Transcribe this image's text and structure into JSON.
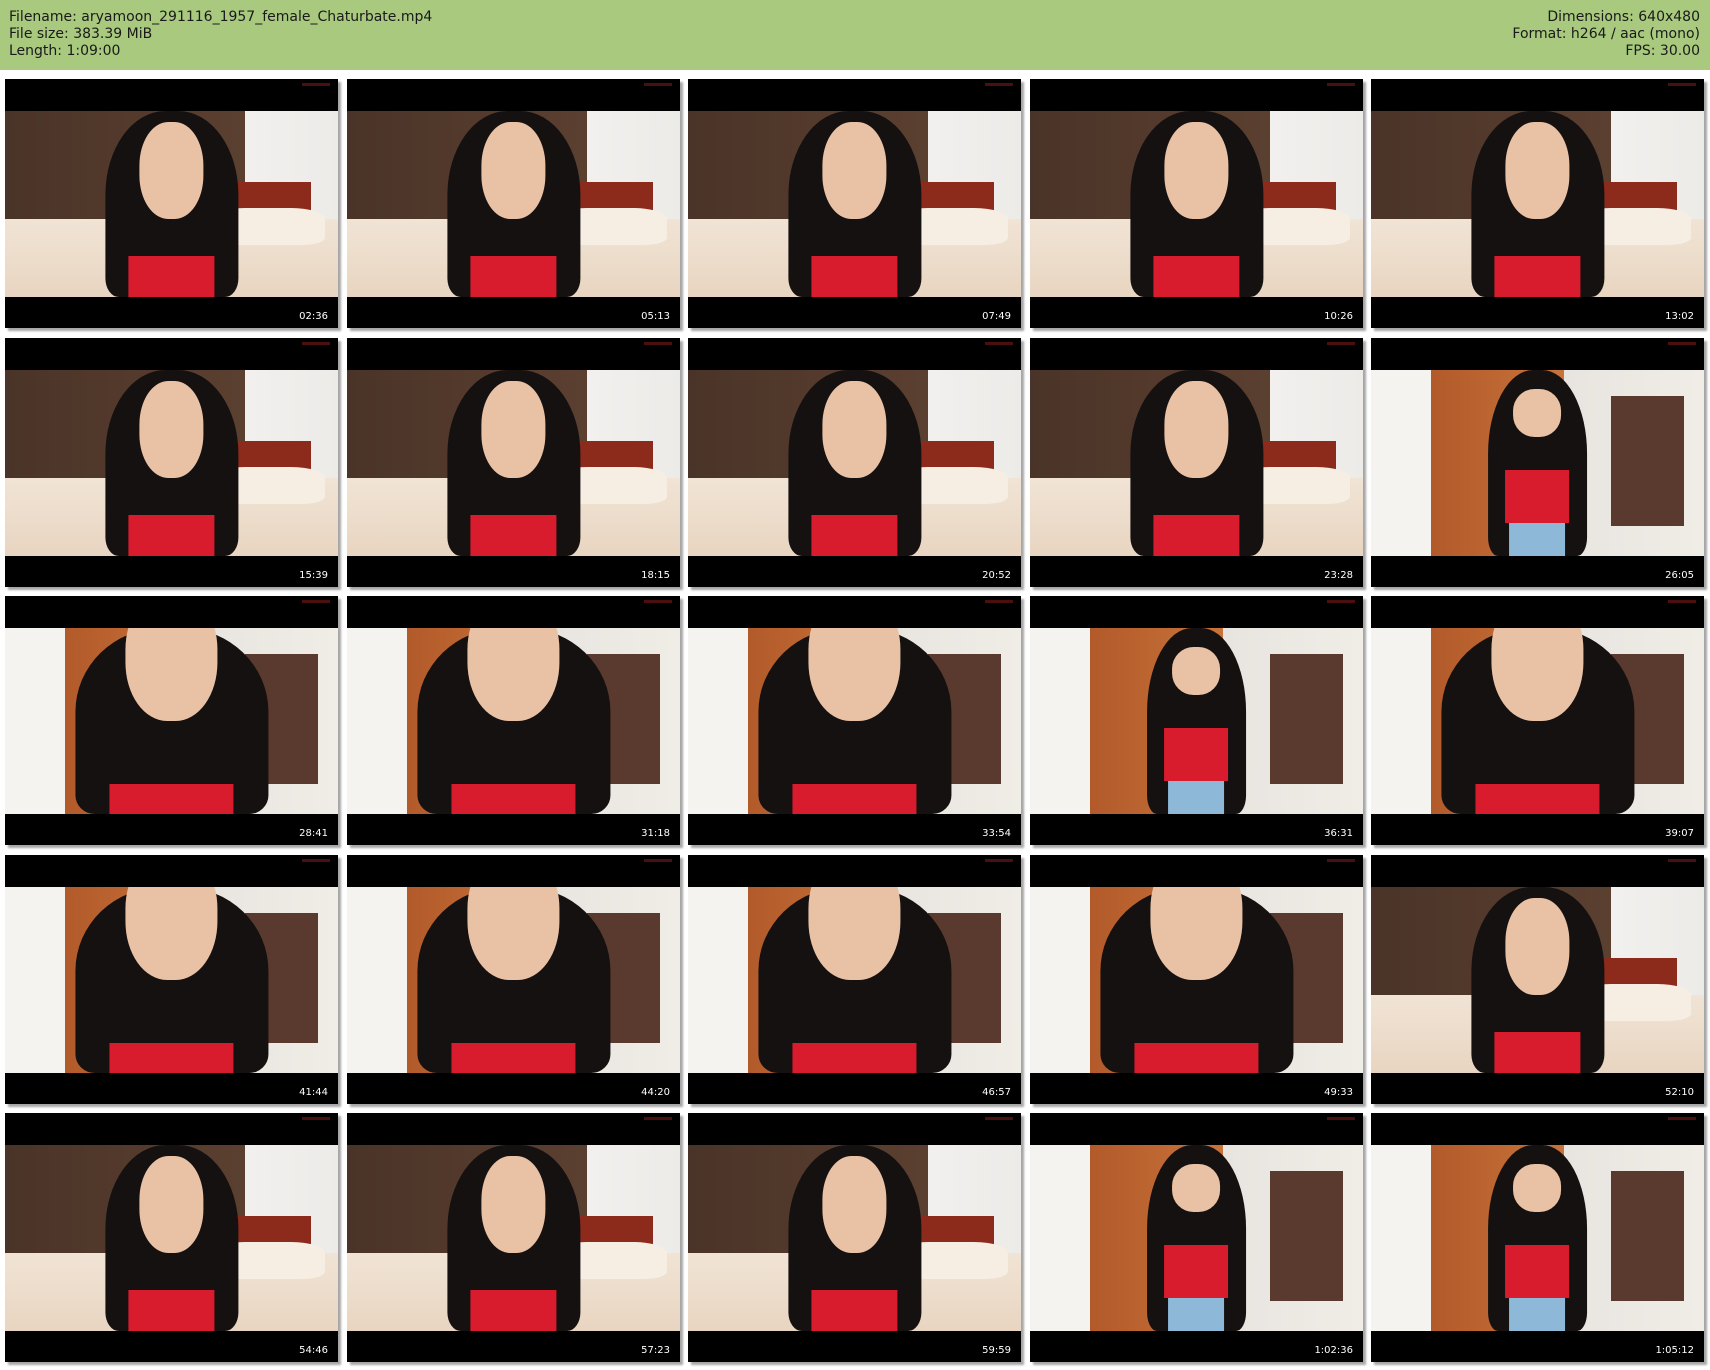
{
  "header": {
    "filename_line": "Filename: aryamoon_291116_1957_female_Chaturbate.mp4",
    "filesize_line": "File size: 383.39 MiB",
    "length_line": "Length: 1:09:00",
    "dimensions_line": "Dimensions: 640x480",
    "format_line": "Format: h264 / aac (mono)",
    "fps_line": "FPS: 30.00"
  },
  "colors": {
    "header_bg": "#a8c97e",
    "thumb_bg": "#000000",
    "top_red": "#d81c2d"
  },
  "thumbnails": [
    {
      "timestamp": "02:36",
      "scene": "bedroom"
    },
    {
      "timestamp": "05:13",
      "scene": "bedroom"
    },
    {
      "timestamp": "07:49",
      "scene": "bedroom"
    },
    {
      "timestamp": "10:26",
      "scene": "bedroom"
    },
    {
      "timestamp": "13:02",
      "scene": "bedroom"
    },
    {
      "timestamp": "15:39",
      "scene": "bedroom"
    },
    {
      "timestamp": "18:15",
      "scene": "bedroom"
    },
    {
      "timestamp": "20:52",
      "scene": "bedroom"
    },
    {
      "timestamp": "23:28",
      "scene": "bedroom"
    },
    {
      "timestamp": "26:05",
      "scene": "wardrobe-small"
    },
    {
      "timestamp": "28:41",
      "scene": "wardrobe-closeup"
    },
    {
      "timestamp": "31:18",
      "scene": "wardrobe-closeup"
    },
    {
      "timestamp": "33:54",
      "scene": "wardrobe-closeup"
    },
    {
      "timestamp": "36:31",
      "scene": "wardrobe-small"
    },
    {
      "timestamp": "39:07",
      "scene": "wardrobe-closeup"
    },
    {
      "timestamp": "41:44",
      "scene": "wardrobe-closeup"
    },
    {
      "timestamp": "44:20",
      "scene": "wardrobe-closeup"
    },
    {
      "timestamp": "46:57",
      "scene": "wardrobe-closeup"
    },
    {
      "timestamp": "49:33",
      "scene": "wardrobe-closeup"
    },
    {
      "timestamp": "52:10",
      "scene": "bedroom"
    },
    {
      "timestamp": "54:46",
      "scene": "bedroom"
    },
    {
      "timestamp": "57:23",
      "scene": "bedroom"
    },
    {
      "timestamp": "59:59",
      "scene": "bedroom"
    },
    {
      "timestamp": "1:02:36",
      "scene": "wardrobe-small"
    },
    {
      "timestamp": "1:05:12",
      "scene": "wardrobe-small"
    }
  ]
}
